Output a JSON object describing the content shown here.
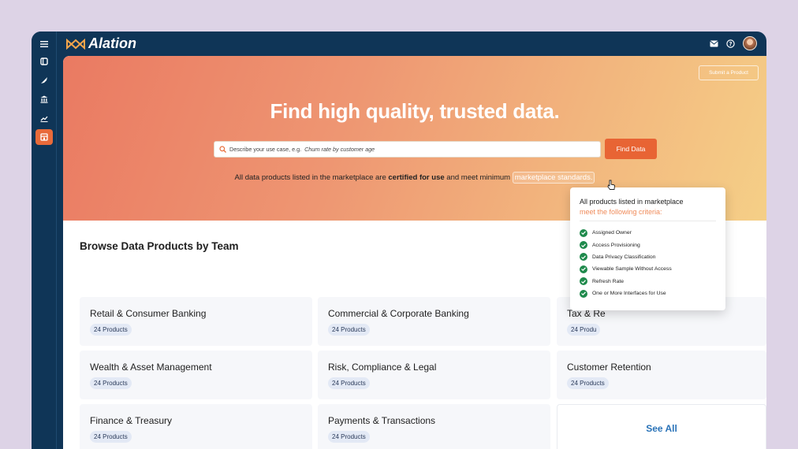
{
  "app": {
    "logo_text": "Alation"
  },
  "rail": {
    "icons": [
      "menu-icon",
      "book-icon",
      "feather-icon",
      "bank-icon",
      "chart-icon",
      "store-icon"
    ]
  },
  "topbar": {
    "icons": [
      "mail-icon",
      "help-icon",
      "avatar"
    ]
  },
  "hero": {
    "submit_label": "Submit a Product",
    "title": "Find high quality, trusted data.",
    "search_placeholder": "Describe your use case, e.g.",
    "search_example": "Churn rate by customer age",
    "find_label": "Find Data",
    "note_prefix": "All data products listed in the marketplace are",
    "note_bold": "certified for use",
    "note_mid": "and meet minimum",
    "note_link": "marketplace standards."
  },
  "browse": {
    "title": "Browse Data Products by Team",
    "teams": [
      {
        "name": "Retail & Consumer Banking",
        "count": "24 Products"
      },
      {
        "name": "Commercial & Corporate Banking",
        "count": "24 Products"
      },
      {
        "name": "Tax & Re",
        "count": "24 Produ"
      },
      {
        "name": "Wealth & Asset Management",
        "count": "24 Products"
      },
      {
        "name": "Risk, Compliance & Legal",
        "count": "24 Products"
      },
      {
        "name": "Customer Retention",
        "count": "24 Products"
      },
      {
        "name": "Finance & Treasury",
        "count": "24 Products"
      },
      {
        "name": "Payments & Transactions",
        "count": "24 Products"
      }
    ],
    "see_all_label": "See All"
  },
  "popover": {
    "title": "All products listed in marketplace",
    "subtitle": "meet the following criteria:",
    "criteria": [
      "Assigned Owner",
      "Access Provisioning",
      "Data Privacy Classification",
      "Viewable Sample Without Access",
      "Refresh Rate",
      "One or More Interfaces for Use"
    ]
  },
  "colors": {
    "accent": "#e86434",
    "navy": "#0f3557",
    "check": "#1f8a4c",
    "link": "#2a73b8"
  }
}
